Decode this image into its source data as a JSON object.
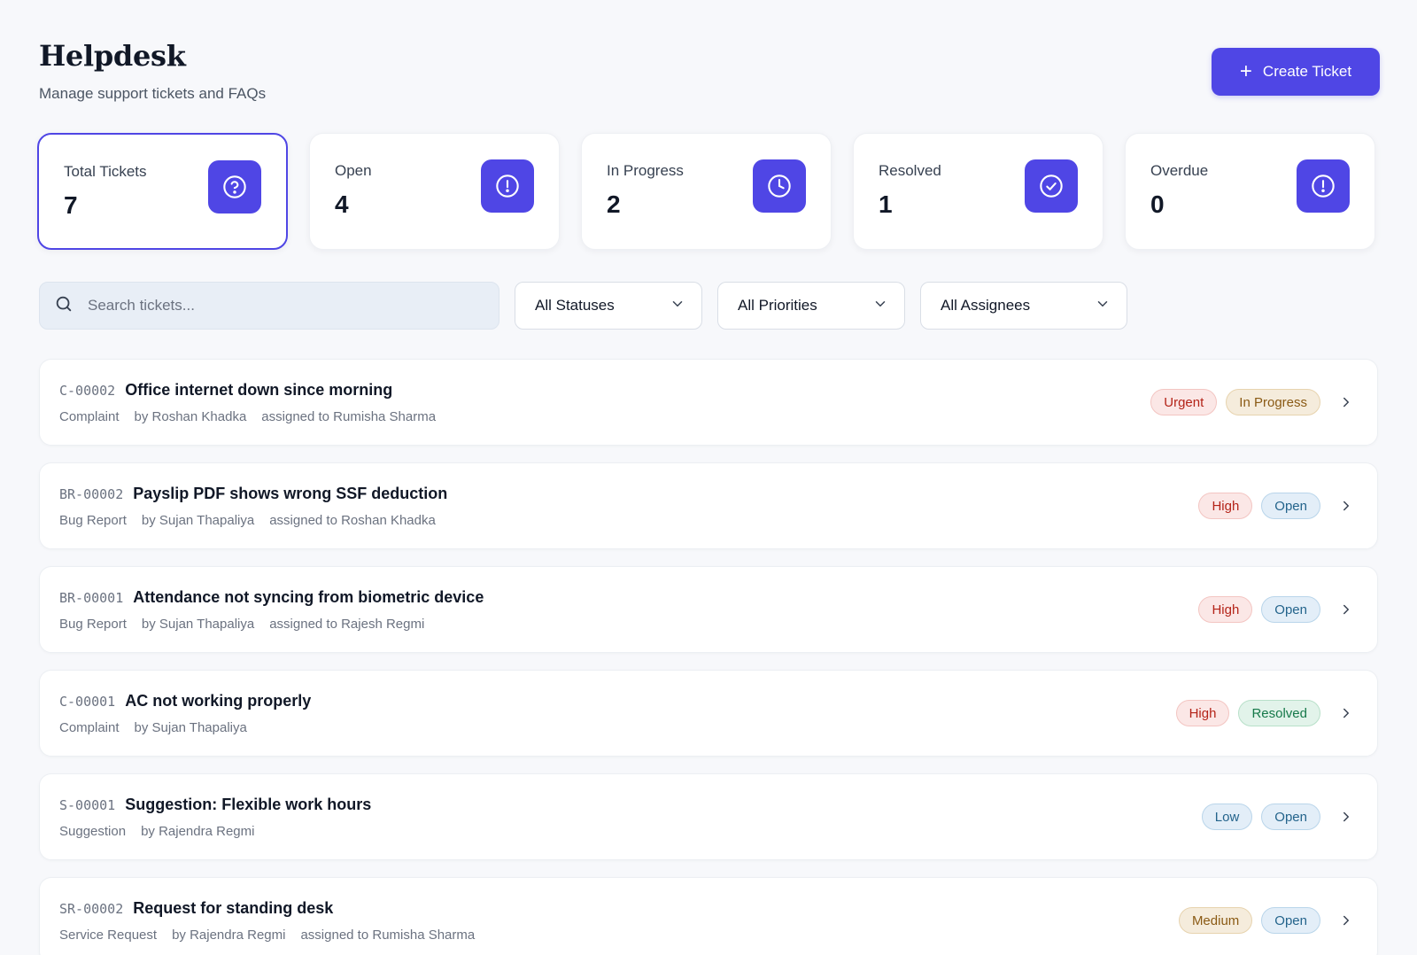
{
  "header": {
    "title": "Helpdesk",
    "subtitle": "Manage support tickets and FAQs",
    "create_label": "Create Ticket"
  },
  "stats": [
    {
      "label": "Total Tickets",
      "value": "7",
      "icon": "question-circle-icon"
    },
    {
      "label": "Open",
      "value": "4",
      "icon": "exclamation-circle-icon"
    },
    {
      "label": "In Progress",
      "value": "2",
      "icon": "clock-icon"
    },
    {
      "label": "Resolved",
      "value": "1",
      "icon": "check-circle-icon"
    },
    {
      "label": "Overdue",
      "value": "0",
      "icon": "exclamation-circle-icon"
    }
  ],
  "filters": {
    "search_placeholder": "Search tickets...",
    "status": "All Statuses",
    "priority": "All Priorities",
    "assignee": "All Assignees"
  },
  "tickets": [
    {
      "code": "C-00002",
      "title": "Office internet down since morning",
      "category": "Complaint",
      "by": "by Roshan Khadka",
      "assigned": "assigned to Rumisha Sharma",
      "priority": "Urgent",
      "status": "In Progress"
    },
    {
      "code": "BR-00002",
      "title": "Payslip PDF shows wrong SSF deduction",
      "category": "Bug Report",
      "by": "by Sujan Thapaliya",
      "assigned": "assigned to Roshan Khadka",
      "priority": "High",
      "status": "Open"
    },
    {
      "code": "BR-00001",
      "title": "Attendance not syncing from biometric device",
      "category": "Bug Report",
      "by": "by Sujan Thapaliya",
      "assigned": "assigned to Rajesh Regmi",
      "priority": "High",
      "status": "Open"
    },
    {
      "code": "C-00001",
      "title": "AC not working properly",
      "category": "Complaint",
      "by": "by Sujan Thapaliya",
      "assigned": "",
      "priority": "High",
      "status": "Resolved"
    },
    {
      "code": "S-00001",
      "title": "Suggestion: Flexible work hours",
      "category": "Suggestion",
      "by": "by Rajendra Regmi",
      "assigned": "",
      "priority": "Low",
      "status": "Open"
    },
    {
      "code": "SR-00002",
      "title": "Request for standing desk",
      "category": "Service Request",
      "by": "by Rajendra Regmi",
      "assigned": "assigned to Rumisha Sharma",
      "priority": "Medium",
      "status": "Open"
    }
  ],
  "colors": {
    "accent": "#4f46e5",
    "background": "#f7f8fb",
    "urgent_high": "#b42318",
    "open_low": "#24648c",
    "medium_inprogress": "#8a5a14",
    "resolved": "#16794a"
  }
}
